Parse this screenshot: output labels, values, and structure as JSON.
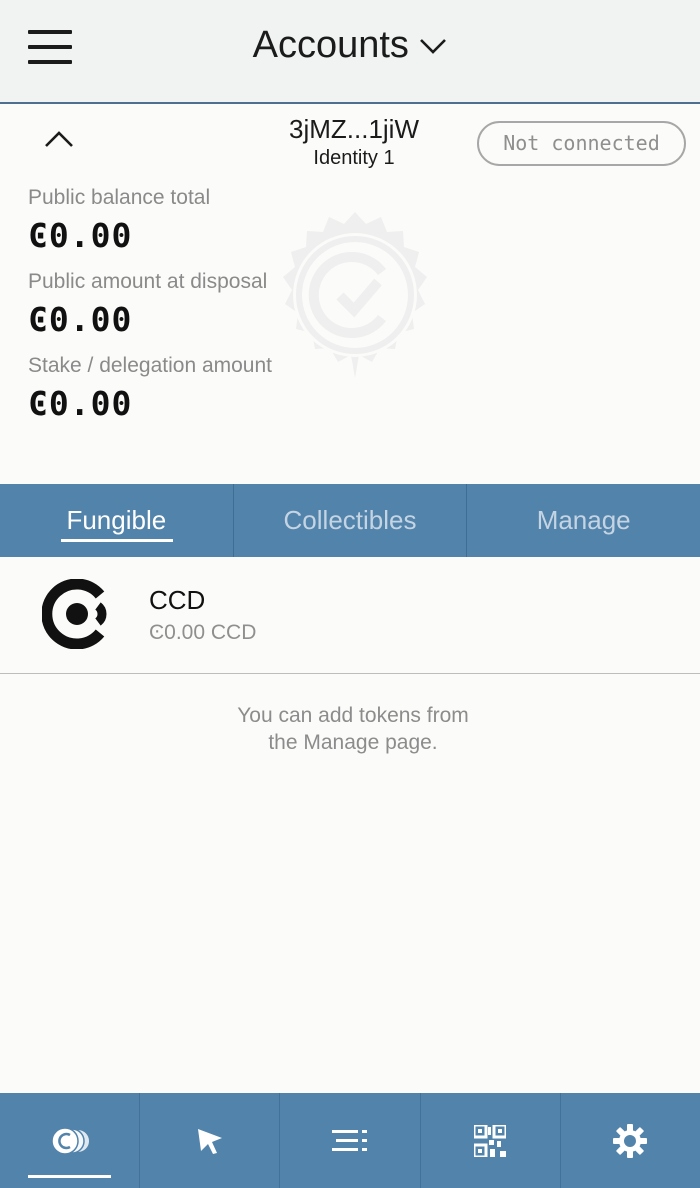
{
  "header": {
    "menu_icon": "hamburger-menu-icon",
    "title": "Accounts",
    "dropdown_icon": "chevron-down-icon"
  },
  "account": {
    "collapse_icon": "chevron-up-icon",
    "address": "3jMZ...1jiW",
    "identity": "Identity 1",
    "connection_status": "Not connected",
    "watermark_icon": "verified-seal-icon",
    "balances": [
      {
        "label": "Public balance total",
        "value": "Ͼ0.00"
      },
      {
        "label": "Public amount at disposal",
        "value": "Ͼ0.00"
      },
      {
        "label": "Stake / delegation amount",
        "value": "Ͼ0.00"
      }
    ]
  },
  "tabs": [
    {
      "label": "Fungible",
      "active": true
    },
    {
      "label": "Collectibles",
      "active": false
    },
    {
      "label": "Manage",
      "active": false
    }
  ],
  "tokens": [
    {
      "icon": "ccd-logo-icon",
      "name": "CCD",
      "balance": "Ͼ0.00 CCD"
    }
  ],
  "hint": {
    "line1": "You can add tokens from",
    "line2": "the Manage page."
  },
  "bottom_nav": [
    {
      "icon": "accounts-coins-icon",
      "active": true
    },
    {
      "icon": "send-arrow-icon",
      "active": false
    },
    {
      "icon": "transaction-list-icon",
      "active": false
    },
    {
      "icon": "qr-code-icon",
      "active": false
    },
    {
      "icon": "settings-gear-icon",
      "active": false
    }
  ],
  "colors": {
    "nav_blue": "#5283ab",
    "header_bg": "#f1f3f3",
    "page_bg": "#fbfbf9",
    "muted_text": "#8a8a8a"
  }
}
